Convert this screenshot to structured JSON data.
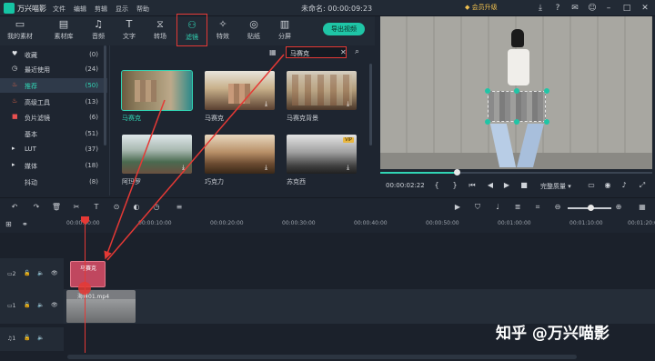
{
  "app": {
    "name": "万兴喵影",
    "doc_title": "未命名: 00:00:09:23",
    "upgrade": "会员升级"
  },
  "menu": [
    "文件",
    "编辑",
    "剪辑",
    "显示",
    "帮助"
  ],
  "toolbar": {
    "items": [
      {
        "label": "我的素材",
        "icon": "folder-icon"
      },
      {
        "label": "素材库",
        "icon": "library-icon"
      },
      {
        "label": "音频",
        "icon": "music-note-icon"
      },
      {
        "label": "文字",
        "icon": "text-icon"
      },
      {
        "label": "转场",
        "icon": "transition-icon"
      },
      {
        "label": "滤镜",
        "icon": "filter-icon"
      },
      {
        "label": "特效",
        "icon": "effects-icon"
      },
      {
        "label": "贴纸",
        "icon": "sticker-icon"
      },
      {
        "label": "分屏",
        "icon": "split-screen-icon"
      }
    ],
    "export": "导出视频"
  },
  "sidebar": [
    {
      "label": "收藏",
      "count": "(0)",
      "icon": "heart-icon"
    },
    {
      "label": "最近使用",
      "count": "(24)",
      "icon": "clock-icon"
    },
    {
      "label": "推荐",
      "count": "(50)",
      "icon": "fire-icon"
    },
    {
      "label": "高级工具",
      "count": "(13)",
      "icon": "fire-icon"
    },
    {
      "label": "负片滤镜",
      "count": "(6)",
      "icon": "square-icon"
    },
    {
      "label": "基本",
      "count": "(51)",
      "icon": ""
    },
    {
      "label": "LUT",
      "count": "(37)",
      "icon": "caret-right-icon"
    },
    {
      "label": "媒体",
      "count": "(18)",
      "icon": "caret-right-icon"
    },
    {
      "label": "抖动",
      "count": "(8)",
      "icon": ""
    }
  ],
  "search": {
    "value": "马赛克"
  },
  "thumbs": [
    {
      "label": "马赛克",
      "selected": true,
      "vip": false
    },
    {
      "label": "马赛克",
      "selected": false,
      "vip": false
    },
    {
      "label": "马赛克背景",
      "selected": false,
      "vip": false
    },
    {
      "label": "阿玛罗",
      "selected": false,
      "vip": false
    },
    {
      "label": "巧克力",
      "selected": false,
      "vip": false
    },
    {
      "label": "苏克西",
      "selected": false,
      "vip": true
    }
  ],
  "vip_badge": "VIP",
  "player": {
    "timecode": "00:00:02:22",
    "quality": "完整质量",
    "progress": 0.28
  },
  "ruler": {
    "ticks": [
      "00:00:00:00",
      "00:00:10:00",
      "00:00:20:00",
      "00:00:30:00",
      "00:00:40:00",
      "00:00:50:00",
      "00:01:00:00",
      "00:01:10:00",
      "00:01:20:00"
    ]
  },
  "tracks": {
    "filter_track": "2",
    "video_track": "1",
    "audio_track": "1",
    "filter_clip": "马赛克",
    "video_clip": "海景01.mp4"
  },
  "watermark": "知乎 @万兴喵影"
}
